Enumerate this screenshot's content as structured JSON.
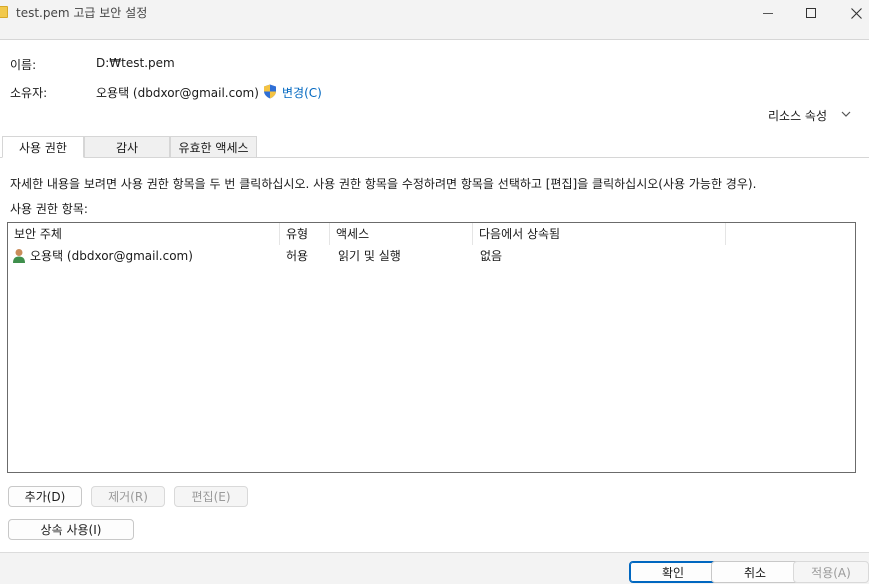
{
  "window": {
    "title": "test.pem 고급 보안 설정"
  },
  "info": {
    "name_label": "이름:",
    "name_value": "D:₩test.pem",
    "owner_label": "소유자:",
    "owner_value": "오용택 (dbdxor@gmail.com)",
    "change_link": "변경(C)",
    "resource_props": "리소스 속성"
  },
  "tabs": [
    {
      "label": "사용 권한",
      "active": true
    },
    {
      "label": "감사",
      "active": false
    },
    {
      "label": "유효한 액세스",
      "active": false
    }
  ],
  "description": "자세한 내용을 보려면 사용 권한 항목을 두 번 클릭하십시오. 사용 권한 항목을 수정하려면 항목을 선택하고 [편집]을 클릭하십시오(사용 가능한 경우).",
  "entries_label": "사용 권한 항목:",
  "table": {
    "columns": [
      "보안 주체",
      "유형",
      "액세스",
      "다음에서 상속됨"
    ],
    "rows": [
      {
        "principal": "오용택 (dbdxor@gmail.com)",
        "type": "허용",
        "access": "읽기 및 실행",
        "inherited_from": "없음"
      }
    ]
  },
  "buttons": {
    "add": "추가(D)",
    "remove": "제거(R)",
    "edit": "편집(E)",
    "inherit": "상속 사용(I)",
    "ok": "확인",
    "cancel": "취소",
    "apply": "적용(A)"
  },
  "colors": {
    "accent": "#0067c0",
    "link": "#0067c0"
  },
  "icons": [
    "folder-icon",
    "minimize-icon",
    "maximize-icon",
    "close-icon",
    "uac-shield-icon",
    "chevron-down-icon",
    "user-icon"
  ]
}
